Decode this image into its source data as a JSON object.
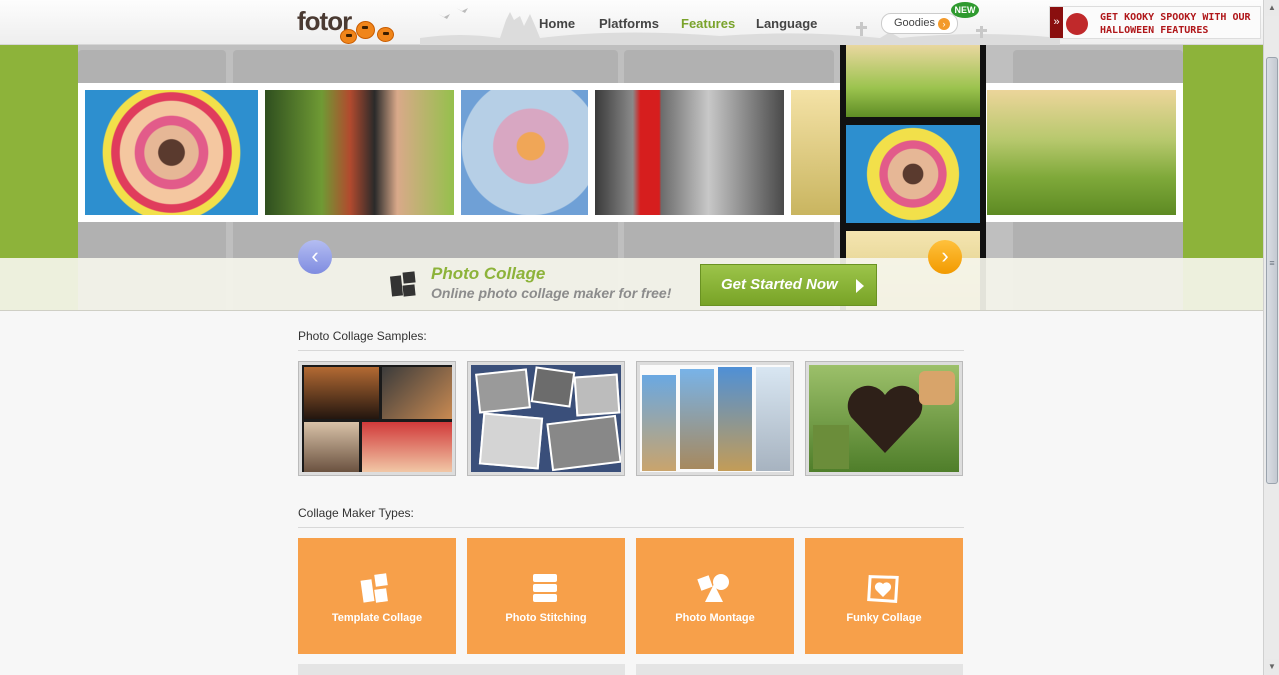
{
  "header": {
    "logo": "fotor",
    "nav": [
      "Home",
      "Platforms",
      "Features",
      "Language"
    ],
    "goodies_label": "Goodies",
    "goodies_arrow": "›",
    "new_badge": "NEW",
    "halloween_text": "GET KOOKY SPOOKY WITH OUR HALLOWEEN FEATURES",
    "halloween_arrow": "»"
  },
  "hero": {
    "title": "Photo Collage",
    "subtitle": "Online photo collage maker for free!",
    "cta_label": "Get Started Now",
    "prev_glyph": "‹",
    "next_glyph": "›"
  },
  "samples": {
    "title": "Photo Collage Samples:"
  },
  "types": {
    "title": "Collage Maker Types:",
    "items": [
      "Template Collage",
      "Photo Stitching",
      "Photo Montage",
      "Funky Collage"
    ]
  },
  "scrollbar": {
    "up": "▲",
    "down": "▼",
    "grip": "≡"
  },
  "colors": {
    "brand_green": "#8db33a",
    "accent_orange": "#f7a04a",
    "halloween_red": "#b0171a"
  }
}
